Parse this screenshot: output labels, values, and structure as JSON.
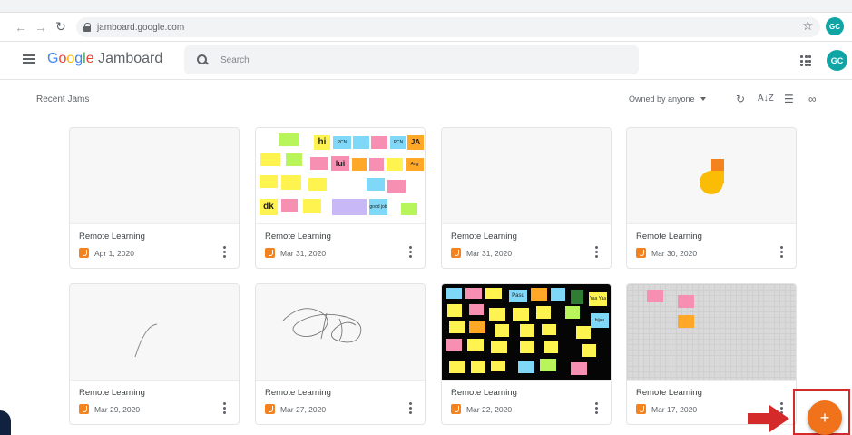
{
  "browser": {
    "url": "jamboard.google.com",
    "avatar_initials": "GC"
  },
  "app": {
    "logo_google": [
      "G",
      "o",
      "o",
      "g",
      "l",
      "e"
    ],
    "logo_product": "Jamboard",
    "search_placeholder": "Search",
    "avatar_initials": "GC"
  },
  "toolbar": {
    "section_title": "Recent Jams",
    "owner_filter": "Owned by anyone"
  },
  "jams": [
    {
      "title": "Remote Learning",
      "date": "Apr 1, 2020"
    },
    {
      "title": "Remote Learning",
      "date": "Mar 31, 2020"
    },
    {
      "title": "Remote Learning",
      "date": "Mar 31, 2020"
    },
    {
      "title": "Remote Learning",
      "date": "Mar 30, 2020"
    },
    {
      "title": "Remote Learning",
      "date": "Mar 29, 2020"
    },
    {
      "title": "Remote Learning",
      "date": "Mar 27, 2020"
    },
    {
      "title": "Remote Learning",
      "date": "Mar 22, 2020"
    },
    {
      "title": "Remote Learning",
      "date": "Mar 17, 2020"
    }
  ],
  "thumb2_notes": [
    "hi",
    "PCN",
    "lui",
    "PCN",
    "JA",
    "dk",
    "good job",
    "Ang"
  ],
  "thumb7_notes": [
    "Pasu",
    "Yaa Yaa",
    "hijau"
  ],
  "fab_label": "+",
  "colors": {
    "accent": "#f0731c",
    "avatar": "#10a4a5",
    "annotation": "#d52a2a"
  }
}
